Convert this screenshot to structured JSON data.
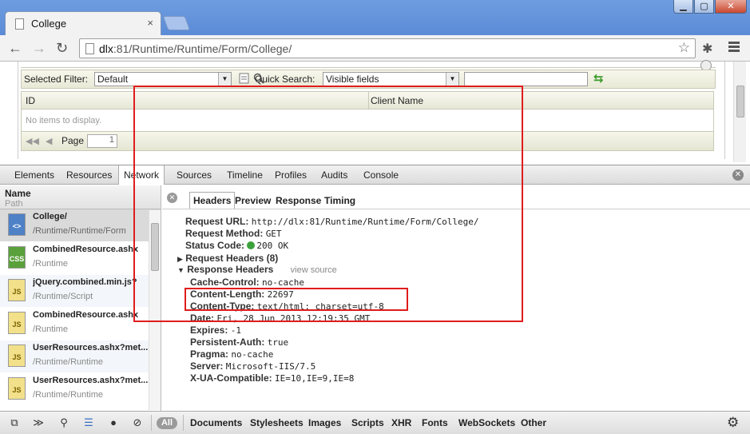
{
  "browser": {
    "tab_title": "College",
    "tab_close": "×",
    "url_host": "dlx",
    "url_rest": ":81/Runtime/Runtime/Form/College/",
    "window_min": "▁",
    "window_max": "▢",
    "window_close": "✕"
  },
  "page": {
    "selected_filter_label": "Selected Filter:",
    "selected_filter_value": "Default",
    "quick_search_label": "Quick Search:",
    "quick_search_value": "Visible fields",
    "grid_col_id": "ID",
    "grid_col_client": "Client Name",
    "empty_text": "No items to display.",
    "page_label": "Page",
    "page_number": "1"
  },
  "devtools": {
    "tabs": [
      "Elements",
      "Resources",
      "Network",
      "Sources",
      "Timeline",
      "Profiles",
      "Audits",
      "Console"
    ],
    "active_tab": "Network",
    "list_header_name": "Name",
    "list_header_path": "Path",
    "requests": [
      {
        "name": "College/",
        "path": "/Runtime/Runtime/Form",
        "type": "doc",
        "type_label": "<>"
      },
      {
        "name": "CombinedResource.ashx",
        "path": "/Runtime",
        "type": "css",
        "type_label": "CSS"
      },
      {
        "name": "jQuery.combined.min.js?",
        "path": "/Runtime/Script",
        "type": "js",
        "type_label": "JS"
      },
      {
        "name": "CombinedResource.ashx",
        "path": "/Runtime",
        "type": "js",
        "type_label": "JS"
      },
      {
        "name": "UserResources.ashx?met...",
        "path": "/Runtime/Runtime",
        "type": "js",
        "type_label": "JS"
      },
      {
        "name": "UserResources.ashx?met...",
        "path": "/Runtime/Runtime",
        "type": "js",
        "type_label": "JS"
      }
    ],
    "subtabs": [
      "Headers",
      "Preview",
      "Response",
      "Timing"
    ],
    "request_url_k": "Request URL:",
    "request_url_v": "http://dlx:81/Runtime/Runtime/Form/College/",
    "request_method_k": "Request Method:",
    "request_method_v": "GET",
    "status_code_k": "Status Code:",
    "status_code_v": "200 OK",
    "request_headers_title": "Request Headers (8)",
    "response_headers_title": "Response Headers",
    "view_source": "view source",
    "response_headers": [
      {
        "k": "Cache-Control:",
        "v": "no-cache"
      },
      {
        "k": "Content-Length:",
        "v": "22697"
      },
      {
        "k": "Content-Type:",
        "v": "text/html; charset=utf-8"
      },
      {
        "k": "Date:",
        "v": "Fri, 28 Jun 2013 12:19:35 GMT"
      },
      {
        "k": "Expires:",
        "v": "-1"
      },
      {
        "k": "Persistent-Auth:",
        "v": "true"
      },
      {
        "k": "Pragma:",
        "v": "no-cache"
      },
      {
        "k": "Server:",
        "v": "Microsoft-IIS/7.5"
      },
      {
        "k": "X-UA-Compatible:",
        "v": "IE=10,IE=9,IE=8"
      }
    ],
    "filter_all": "All",
    "filter_types": [
      "Documents",
      "Stylesheets",
      "Images",
      "Scripts",
      "XHR",
      "Fonts",
      "WebSockets",
      "Other"
    ]
  },
  "colors": {
    "annotation": "#e01c1c",
    "status_ok": "#3ca13c",
    "titlebar": "#6f9de0"
  }
}
